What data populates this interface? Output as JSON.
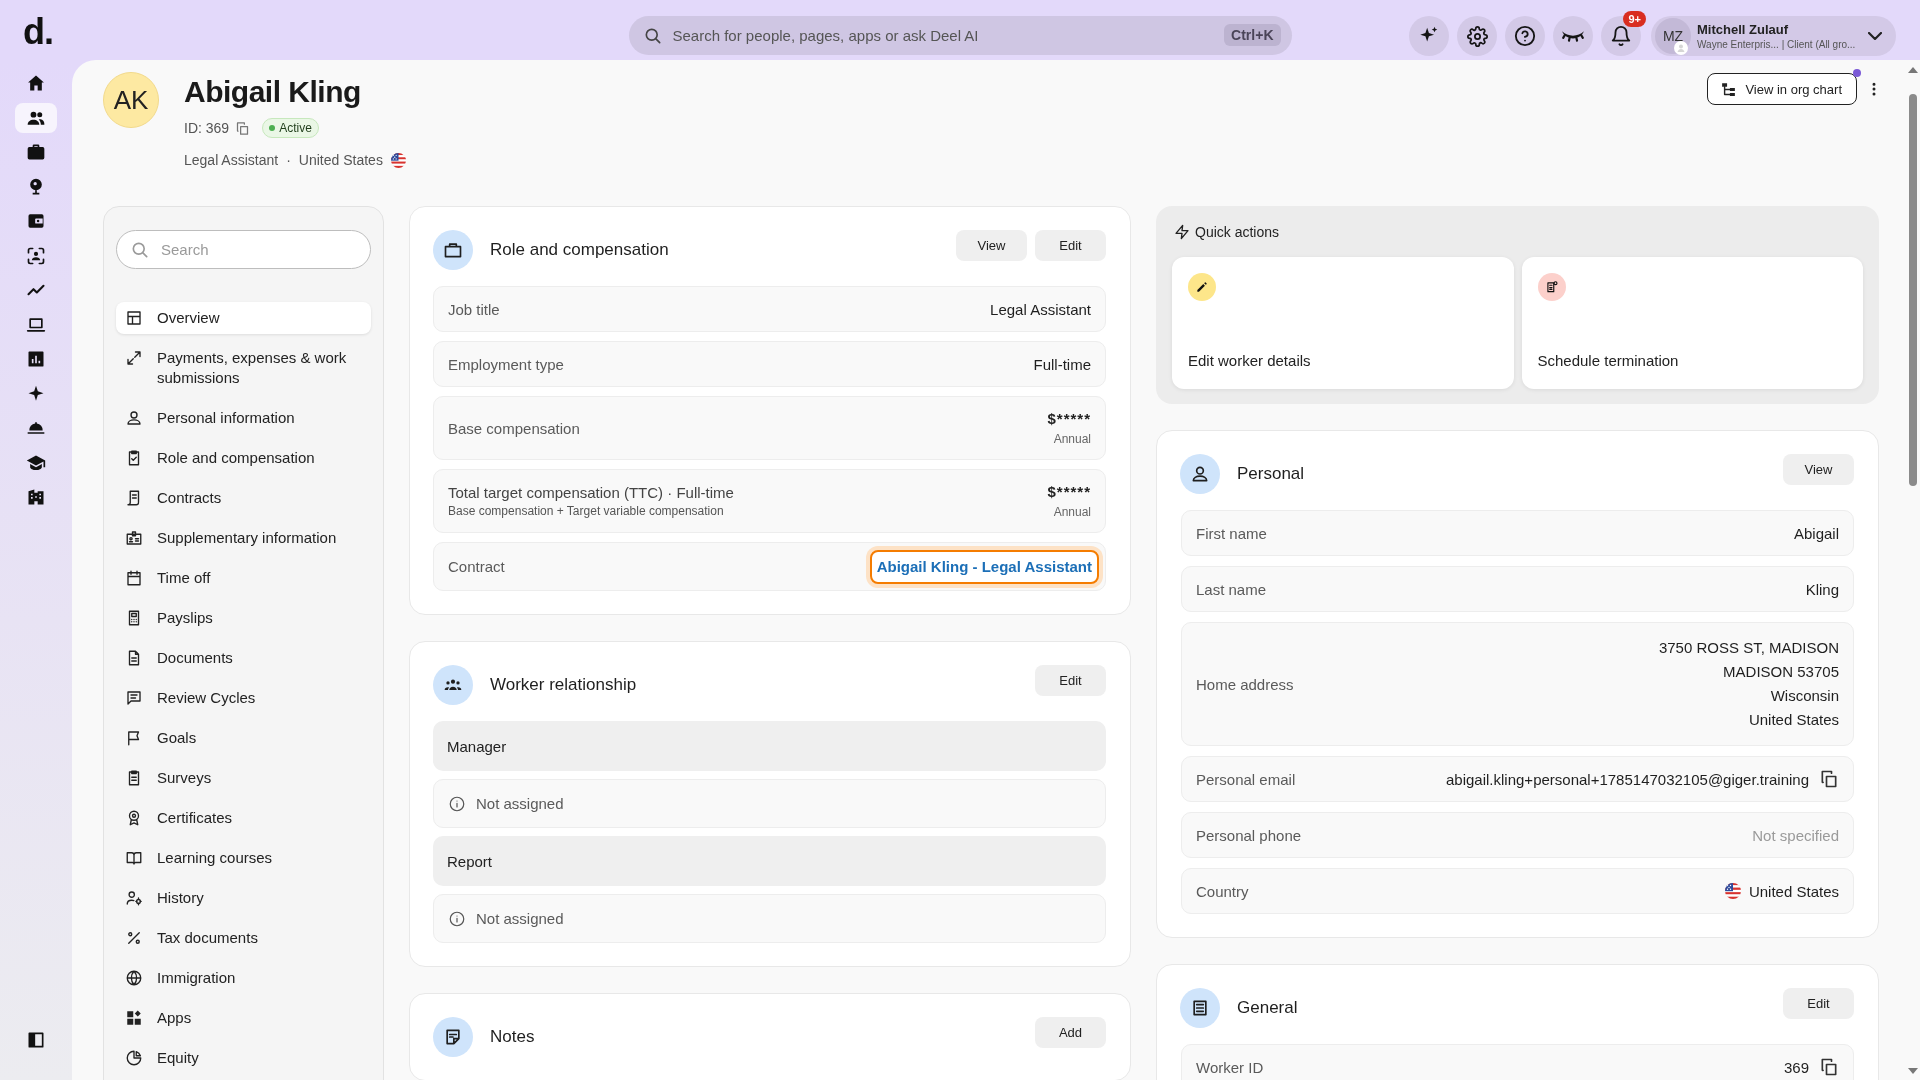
{
  "top_bar": {
    "logo": "d.",
    "search": {
      "placeholder": "Search for people, pages, apps or ask Deel AI",
      "shortcut": "Ctrl+K"
    },
    "notifications": {
      "count": "9+"
    },
    "account": {
      "initials": "MZ",
      "name": "Mitchell Zulauf",
      "organization": "Wayne Enterpris... | Client (All gro..."
    }
  },
  "rail": {
    "items": [
      {
        "selected": false
      },
      {
        "selected": true
      },
      {
        "selected": false
      },
      {
        "selected": false
      },
      {
        "selected": false
      },
      {
        "selected": false
      },
      {
        "selected": false
      },
      {
        "selected": false
      },
      {
        "selected": false
      },
      {
        "selected": false
      },
      {
        "selected": false
      },
      {
        "selected": false
      },
      {
        "selected": false
      }
    ]
  },
  "profile": {
    "initials": "AK",
    "name": "Abigail Kling",
    "id": "ID: 369",
    "status": "Active",
    "job_title": "Legal Assistant",
    "separator": "·",
    "country": "United States",
    "flag": true,
    "org_chart_button": {
      "label": "View in org chart",
      "unread": true
    }
  },
  "sidebar": {
    "search": {
      "placeholder": "Search"
    },
    "items": [
      {
        "label": "Overview",
        "selected": true
      },
      {
        "label": "Payments, expenses & work submissions",
        "selected": false
      },
      {
        "label": "Personal information",
        "selected": false
      },
      {
        "label": "Role and compensation",
        "selected": false
      },
      {
        "label": "Contracts",
        "selected": false
      },
      {
        "label": "Supplementary information",
        "selected": false
      },
      {
        "label": "Time off",
        "selected": false
      },
      {
        "label": "Payslips",
        "selected": false
      },
      {
        "label": "Documents",
        "selected": false
      },
      {
        "label": "Review Cycles",
        "selected": false
      },
      {
        "label": "Goals",
        "selected": false
      },
      {
        "label": "Surveys",
        "selected": false
      },
      {
        "label": "Certificates",
        "selected": false
      },
      {
        "label": "Learning courses",
        "selected": false
      },
      {
        "label": "History",
        "selected": false
      },
      {
        "label": "Tax documents",
        "selected": false
      },
      {
        "label": "Immigration",
        "selected": false
      },
      {
        "label": "Apps",
        "selected": false
      },
      {
        "label": "Equity",
        "selected": false
      }
    ]
  },
  "role_card": {
    "title": "Role and compensation",
    "buttons": [
      "View",
      "Edit"
    ],
    "rows": [
      {
        "kind": "text",
        "label": "Job title",
        "value": "Legal Assistant"
      },
      {
        "kind": "text",
        "label": "Employment type",
        "value": "Full-time"
      },
      {
        "kind": "amount",
        "label": "Base compensation",
        "value": "$*****",
        "note": "Annual"
      },
      {
        "kind": "amount",
        "label": "Total target compensation (TTC) · Full-time",
        "sublabel": "Base compensation + Target variable compensation",
        "value": "$*****",
        "note": "Annual"
      },
      {
        "kind": "link",
        "label": "Contract",
        "value": "Abigail Kling - Legal Assistant",
        "focused": true
      }
    ]
  },
  "relationship_card": {
    "title": "Worker relationship",
    "buttons": [
      "Edit"
    ],
    "groups": [
      {
        "heading": "Manager",
        "value": "Not assigned"
      },
      {
        "heading": "Report",
        "value": "Not assigned"
      }
    ]
  },
  "notes_card": {
    "title": "Notes",
    "buttons": [
      "Add"
    ]
  },
  "quick_actions": {
    "title": "Quick actions",
    "actions": [
      {
        "kind": "edit",
        "label": "Edit worker details",
        "color": "#fde68a"
      },
      {
        "kind": "terminate",
        "label": "Schedule termination",
        "color": "#fcd0cb"
      }
    ]
  },
  "personal_card": {
    "title": "Personal",
    "buttons": [
      "View"
    ],
    "rows": [
      {
        "kind": "text",
        "label": "First name",
        "value": "Abigail"
      },
      {
        "kind": "text",
        "label": "Last name",
        "value": "Kling"
      },
      {
        "kind": "lines",
        "label": "Home address",
        "lines": [
          "3750 ROSS ST, MADISON",
          "MADISON 53705",
          "Wisconsin",
          "United States"
        ]
      },
      {
        "kind": "copyable",
        "label": "Personal email",
        "value": "abigail.kling+personal+1785147032105@giger.training"
      },
      {
        "kind": "empty",
        "label": "Personal phone",
        "value": "Not specified"
      },
      {
        "kind": "flag",
        "label": "Country",
        "value": "United States"
      }
    ]
  },
  "general_card": {
    "title": "General",
    "buttons": [
      "Edit"
    ],
    "rows": [
      {
        "kind": "copyable",
        "label": "Worker ID",
        "value": "369"
      }
    ]
  }
}
